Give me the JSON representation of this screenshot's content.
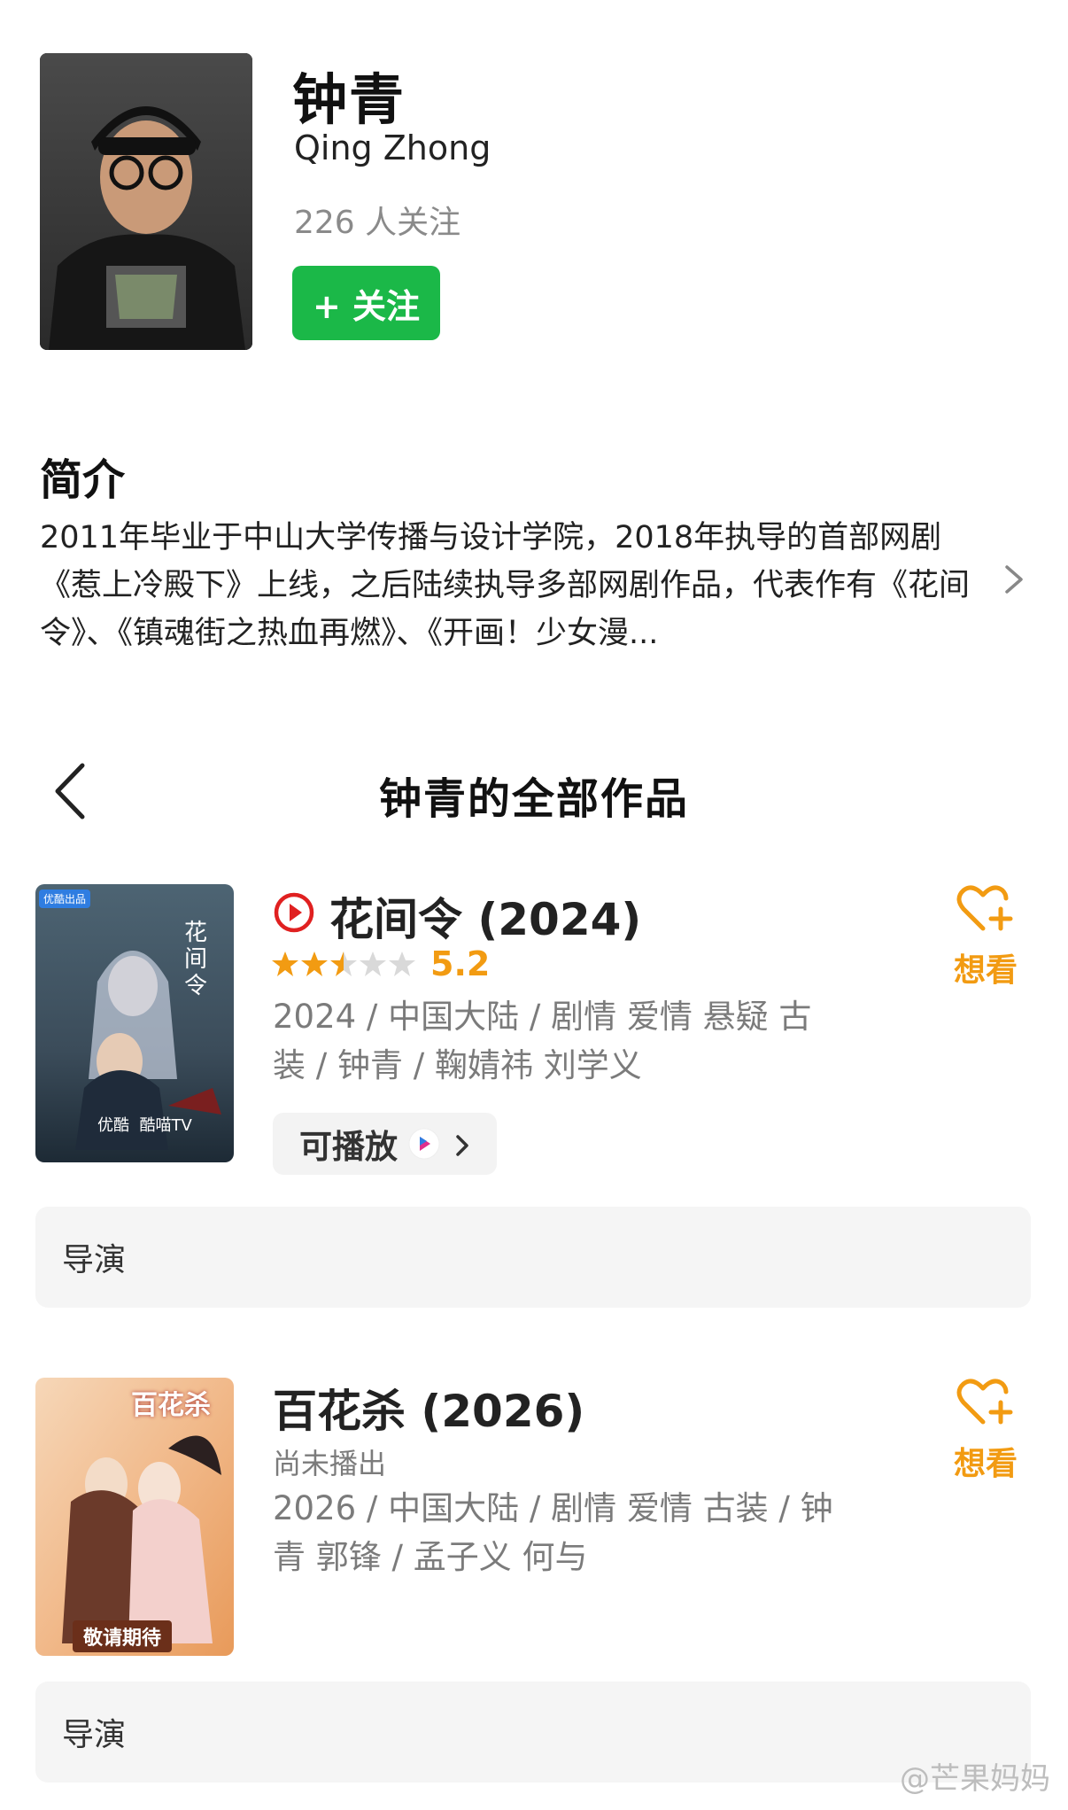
{
  "profile": {
    "name_cn": "钟青",
    "name_en": "Qing Zhong",
    "followers": "226 人关注",
    "follow_label": "+ 关注"
  },
  "intro": {
    "title": "简介",
    "text": "2011年毕业于中山大学传播与设计学院，2018年执导的首部网剧《惹上冷殿下》上线，之后陆续执导多部网剧作品，代表作有《花间令》、《镇魂街之热血再燃》、《开画！少女漫..."
  },
  "works": {
    "title": "钟青的全部作品",
    "items": [
      {
        "title": "花间令 (2024)",
        "rating": "5.2",
        "stars_filled": 2.5,
        "meta": "2024 / 中国大陆 / 剧情 爱情 悬疑 古装 / 钟青 / 鞠婧祎 刘学义",
        "play_label": "可播放",
        "want_label": "想看",
        "role": "导演",
        "poster_badge": "优酷出品",
        "poster_title": "花间令",
        "poster_platforms": "优酷  酷喵TV"
      },
      {
        "title": "百花杀 (2026)",
        "status": "尚未播出",
        "meta": "2026 / 中国大陆 / 剧情 爱情 古装 / 钟青 郭锋 / 孟子义 何与",
        "want_label": "想看",
        "role": "导演",
        "poster_title": "百花杀",
        "poster_caption": "敬请期待"
      }
    ]
  },
  "watermark": "@芒果妈妈",
  "colors": {
    "accent_green": "#1bb848",
    "accent_orange": "#f29b12",
    "play_red": "#e02020"
  }
}
